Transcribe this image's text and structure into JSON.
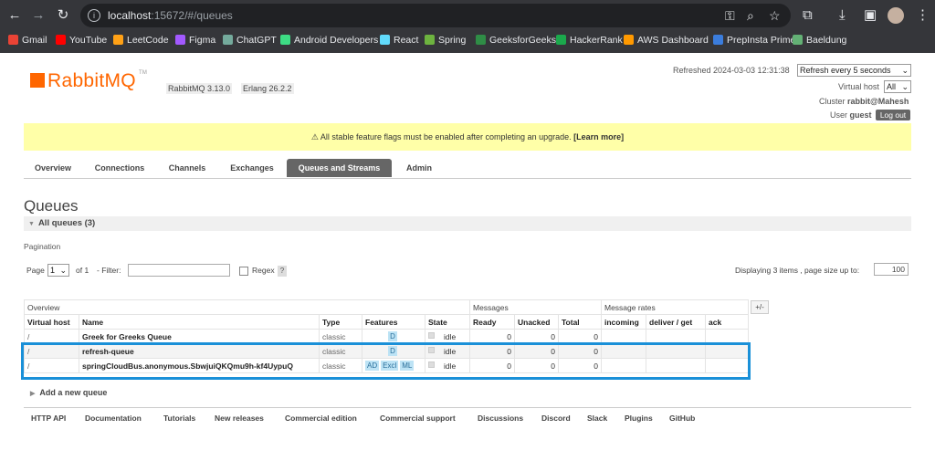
{
  "browser": {
    "url_host": "localhost",
    "url_rest": ":15672/#/queues",
    "bookmarks": [
      {
        "label": "Gmail",
        "color": "#ea4335"
      },
      {
        "label": "YouTube",
        "color": "#ff0000"
      },
      {
        "label": "LeetCode",
        "color": "#ffa116"
      },
      {
        "label": "Figma",
        "color": "#a259ff"
      },
      {
        "label": "ChatGPT",
        "color": "#74aa9c"
      },
      {
        "label": "Android Developers",
        "color": "#3ddc84"
      },
      {
        "label": "React",
        "color": "#61dafb"
      },
      {
        "label": "Spring",
        "color": "#6db33f"
      },
      {
        "label": "GeeksforGeeks",
        "color": "#2f8d46"
      },
      {
        "label": "HackerRank",
        "color": "#1ba94c"
      },
      {
        "label": "AWS Dashboard",
        "color": "#ff9900"
      },
      {
        "label": "PrepInsta Prime",
        "color": "#3b7ddd"
      },
      {
        "label": "Baeldung",
        "color": "#63b175"
      }
    ]
  },
  "header": {
    "logo_text": "RabbitMQ",
    "logo_tm": "TM",
    "rabbitmq_version": "RabbitMQ 3.13.0",
    "erlang_version": "Erlang 26.2.2",
    "refreshed": "Refreshed 2024-03-03 12:31:38",
    "refresh_option": "Refresh every 5 seconds",
    "virtual_host_label": "Virtual host",
    "virtual_host_value": "All",
    "cluster_label": "Cluster",
    "cluster_value": "rabbit@Mahesh",
    "user_label": "User",
    "user_value": "guest",
    "logout_label": "Log out"
  },
  "banner": {
    "text": "⚠ All stable feature flags must be enabled after completing an upgrade.",
    "link": "[Learn more]"
  },
  "tabs": [
    "Overview",
    "Connections",
    "Channels",
    "Exchanges",
    "Queues and Streams",
    "Admin"
  ],
  "page": {
    "title": "Queues",
    "section": "All queues (3)",
    "pagination_label": "Pagination",
    "page_label": "Page",
    "page_value": "1",
    "of_label": "of 1",
    "filter_label": "- Filter:",
    "regex_label": "Regex",
    "help": "?",
    "displaying": "Displaying 3 items , page size up to:",
    "page_size": "100",
    "plus_minus": "+/-",
    "add_queue": "Add a new queue"
  },
  "table": {
    "group_headers": {
      "overview": "Overview",
      "messages": "Messages",
      "rates": "Message rates"
    },
    "columns": [
      "Virtual host",
      "Name",
      "Type",
      "Features",
      "State",
      "Ready",
      "Unacked",
      "Total",
      "incoming",
      "deliver / get",
      "ack"
    ],
    "rows": [
      {
        "vhost": "/",
        "name": "Greek for Greeks Queue",
        "type": "classic",
        "features": [
          "D"
        ],
        "state": "idle",
        "ready": "0",
        "unacked": "0",
        "total": "0"
      },
      {
        "vhost": "/",
        "name": "refresh-queue",
        "type": "classic",
        "features": [
          "D"
        ],
        "state": "idle",
        "ready": "0",
        "unacked": "0",
        "total": "0"
      },
      {
        "vhost": "/",
        "name": "springCloudBus.anonymous.SbwjuiQKQmu9h-kf4UypuQ",
        "type": "classic",
        "features": [
          "AD",
          "Excl",
          "ML"
        ],
        "state": "idle",
        "ready": "0",
        "unacked": "0",
        "total": "0"
      }
    ]
  },
  "footer": [
    "HTTP API",
    "Documentation",
    "Tutorials",
    "New releases",
    "Commercial edition",
    "Commercial support",
    "Discussions",
    "Discord",
    "Slack",
    "Plugins",
    "GitHub"
  ],
  "colors": {
    "brand": "#ff6600",
    "highlight": "#1a90d8",
    "banner": "#ffffa8",
    "feature_badge": "#bde3f5"
  }
}
